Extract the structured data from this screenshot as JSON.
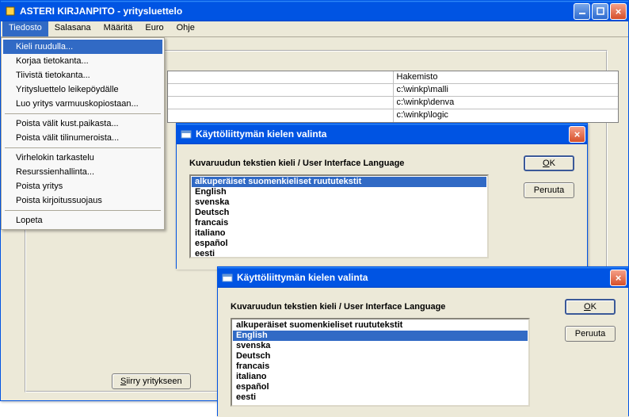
{
  "main_window": {
    "title": "ASTERI KIRJANPITO - yritysluettelo",
    "menu": {
      "items": [
        "Tiedosto",
        "Salasana",
        "Määritä",
        "Euro",
        "Ohje"
      ],
      "open_index": 0,
      "dropdown": [
        "Kieli ruudulla...",
        "Korjaa tietokanta...",
        "Tiivistä tietokanta...",
        "Yritysluettelo leikepöydälle",
        "Luo yritys varmuuskopiostaan...",
        "-",
        "Poista välit kust.paikasta...",
        "Poista välit tilinumeroista...",
        "-",
        "Virhelokin tarkastelu",
        "Resurssienhallinta...",
        "Poista yritys",
        "Poista kirjoitussuojaus",
        "-",
        "Lopeta"
      ],
      "highlight_index": 0
    },
    "table": {
      "header": "Hakemisto",
      "rows": [
        "c:\\winkp\\malli",
        "c:\\winkp\\denva",
        "c:\\winkp\\logic"
      ]
    },
    "go_button": "Siirry yritykseen"
  },
  "dialog1": {
    "title": "Käyttöliittymän kielen valinta",
    "prompt": "Kuvaruudun tekstien kieli / User Interface Language",
    "options": [
      "alkuperäiset suomenkieliset ruututekstit",
      "English",
      "svenska",
      "Deutsch",
      "francais",
      "italiano",
      "español",
      "eesti"
    ],
    "selected_index": 0,
    "ok": "OK",
    "cancel": "Peruuta"
  },
  "dialog2": {
    "title": "Käyttöliittymän kielen valinta",
    "prompt": "Kuvaruudun tekstien kieli / User Interface Language",
    "options": [
      "alkuperäiset suomenkieliset ruututekstit",
      "English",
      "svenska",
      "Deutsch",
      "francais",
      "italiano",
      "español",
      "eesti"
    ],
    "selected_index": 1,
    "ok": "OK",
    "cancel": "Peruuta"
  }
}
